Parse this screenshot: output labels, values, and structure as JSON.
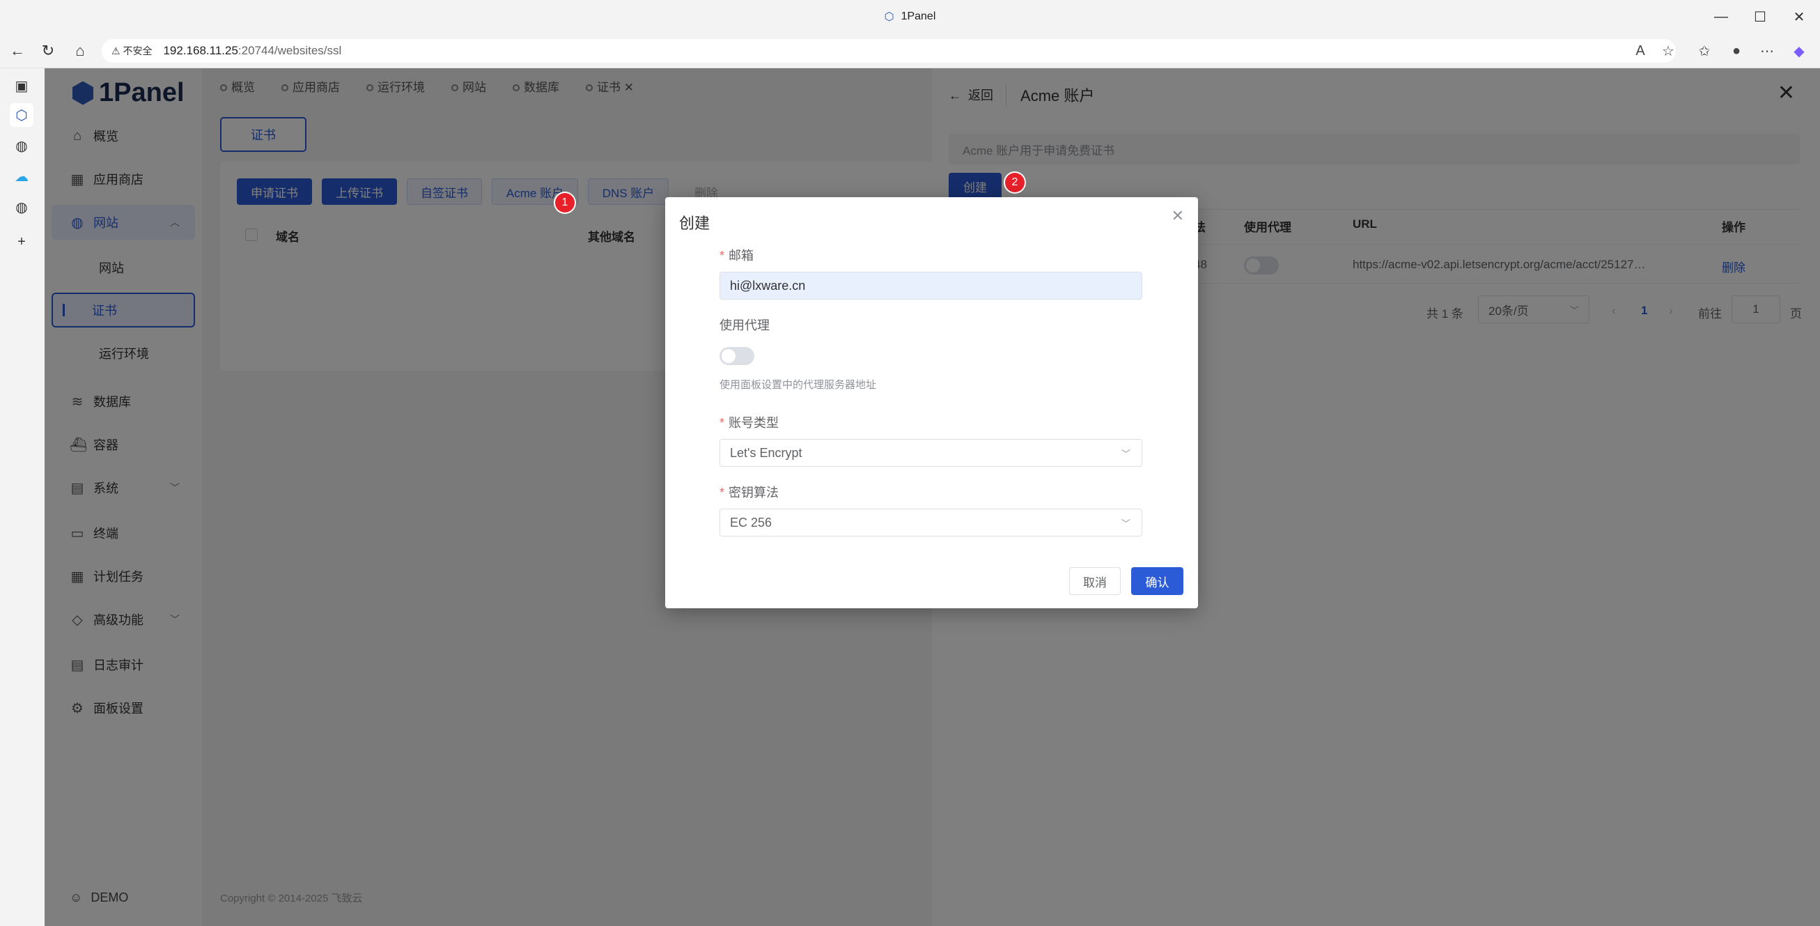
{
  "browser": {
    "window_title": "1Panel",
    "security_label": "不安全",
    "url_host": "192.168.11.25",
    "url_rest": ":20744/websites/ssl"
  },
  "sidebar": {
    "logo": "1Panel",
    "items": [
      {
        "label": "概览",
        "icon": "home-icon"
      },
      {
        "label": "应用商店",
        "icon": "grid-icon"
      },
      {
        "label": "网站",
        "icon": "globe-icon"
      },
      {
        "label": "网站",
        "icon": ""
      },
      {
        "label": "证书",
        "icon": ""
      },
      {
        "label": "运行环境",
        "icon": ""
      },
      {
        "label": "数据库",
        "icon": "layers-icon"
      },
      {
        "label": "容器",
        "icon": "container-icon"
      },
      {
        "label": "系统",
        "icon": "server-icon"
      },
      {
        "label": "终端",
        "icon": "terminal-icon"
      },
      {
        "label": "计划任务",
        "icon": "calendar-icon"
      },
      {
        "label": "高级功能",
        "icon": "diamond-icon"
      },
      {
        "label": "日志审计",
        "icon": "log-icon"
      },
      {
        "label": "面板设置",
        "icon": "gear-icon"
      }
    ],
    "user": "DEMO"
  },
  "tabs": [
    "概览",
    "应用商店",
    "运行环境",
    "网站",
    "数据库",
    "证书"
  ],
  "main": {
    "cert_tab": "证书",
    "buttons": [
      "申请证书",
      "上传证书",
      "自签证书",
      "Acme 账户",
      "DNS 账户",
      "删除"
    ],
    "columns": [
      "域名",
      "其他域名"
    ],
    "footer": "Copyright © 2014-2025 飞致云"
  },
  "drawer": {
    "back": "返回",
    "title": "Acme 账户",
    "description": "Acme 账户用于申请免费证书",
    "create": "创建",
    "columns": {
      "algo_partial": "法",
      "proxy": "使用代理",
      "url": "URL",
      "ops": "操作"
    },
    "row": {
      "algo_partial": "48",
      "url": "https://acme-v02.api.letsencrypt.org/acme/acct/25127…",
      "op": "删除"
    },
    "pager": {
      "total": "共 1 条",
      "size": "20条/页",
      "page": "1",
      "goto": "前往",
      "goto_value": "1",
      "unit": "页"
    }
  },
  "badges": {
    "one": "1",
    "two": "2"
  },
  "modal": {
    "title": "创建",
    "email_label": "邮箱",
    "email_value": "hi@lxware.cn",
    "proxy_label": "使用代理",
    "proxy_hint": "使用面板设置中的代理服务器地址",
    "account_type_label": "账号类型",
    "account_type_value": "Let's Encrypt",
    "key_algo_label": "密钥算法",
    "key_algo_value": "EC 256",
    "cancel": "取消",
    "confirm": "确认"
  },
  "colors": {
    "primary": "#2b5bd7",
    "badge": "#e8202a"
  }
}
